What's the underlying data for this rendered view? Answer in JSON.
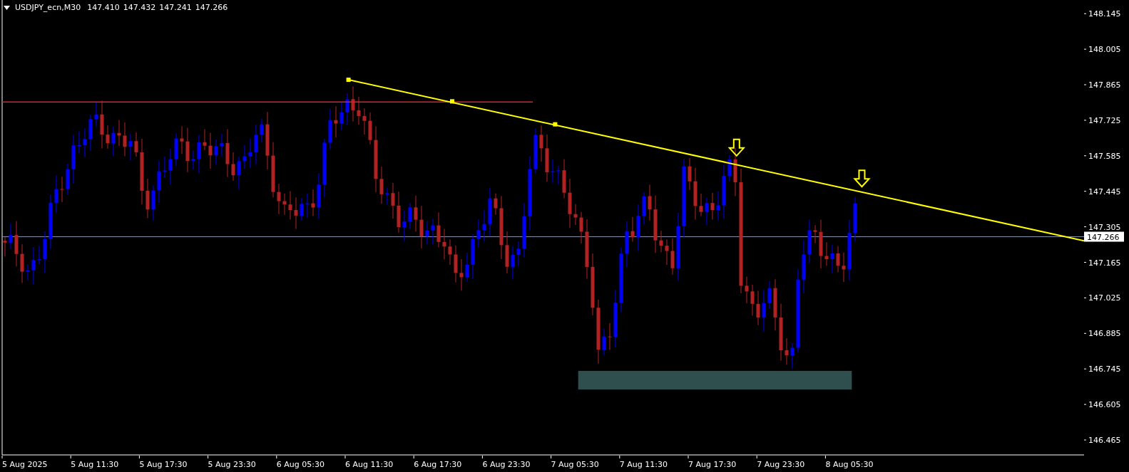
{
  "chart": {
    "symbol": "USDJPY_ecn,M30",
    "ohlc": [
      "147.410",
      "147.432",
      "147.241",
      "147.266"
    ]
  },
  "price_axis": {
    "ticks": [
      "148.145",
      "148.005",
      "147.865",
      "147.725",
      "147.585",
      "147.445",
      "147.305",
      "147.165",
      "147.025",
      "146.885",
      "146.745",
      "146.605",
      "146.465"
    ],
    "current_price": "147.266"
  },
  "time_axis": {
    "labels": [
      "5 Aug 2025",
      "5 Aug 11:30",
      "5 Aug 17:30",
      "5 Aug 23:30",
      "6 Aug 05:30",
      "6 Aug 11:30",
      "6 Aug 17:30",
      "6 Aug 23:30",
      "7 Aug 05:30",
      "7 Aug 11:30",
      "7 Aug 17:30",
      "7 Aug 23:30",
      "8 Aug 05:30"
    ]
  }
}
